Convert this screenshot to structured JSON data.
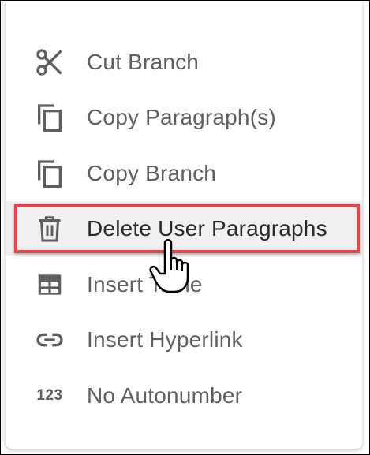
{
  "menu": {
    "items": [
      {
        "label": "Cut Branch",
        "icon": "scissors-icon"
      },
      {
        "label": "Copy Paragraph(s)",
        "icon": "copy-icon"
      },
      {
        "label": "Copy Branch",
        "icon": "copy-icon"
      },
      {
        "label": "Delete User Paragraphs",
        "icon": "trash-icon",
        "highlighted": true
      },
      {
        "label": "Insert Table",
        "icon": "table-icon"
      },
      {
        "label": "Insert Hyperlink",
        "icon": "link-icon"
      },
      {
        "label": "No Autonumber",
        "icon": "number-icon",
        "icon_text": "123"
      }
    ]
  },
  "colors": {
    "text": "#5f5f5f",
    "highlight_border": "#e8454a",
    "highlight_bg": "#f0f0f0"
  }
}
